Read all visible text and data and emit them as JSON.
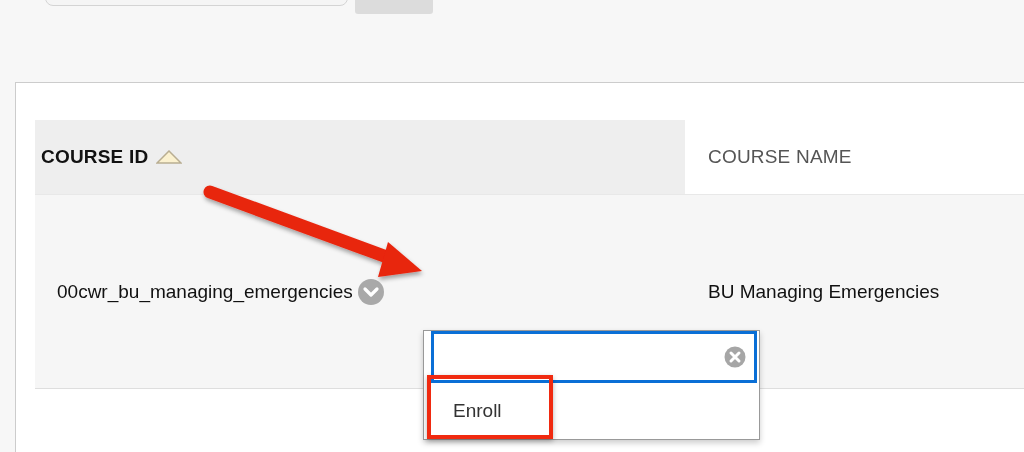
{
  "table": {
    "columns": [
      {
        "label": "COURSE ID",
        "sorted": true
      },
      {
        "label": "COURSE NAME",
        "sorted": false
      }
    ],
    "rows": [
      {
        "cells": [
          "00cwr_bu_managing_emergencies",
          "BU Managing Emergencies"
        ]
      }
    ]
  },
  "context_menu": {
    "items": [
      {
        "label": "Enroll",
        "highlighted": true
      }
    ]
  }
}
